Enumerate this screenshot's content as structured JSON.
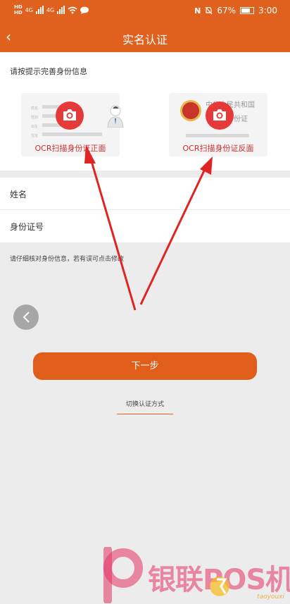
{
  "status_bar": {
    "hd1": "HD",
    "hd2": "HD",
    "net1": "4G",
    "net2": "4G",
    "battery": "67%",
    "time": "3:00"
  },
  "nav": {
    "back_glyph": "‹",
    "title": "实名认证"
  },
  "id_section": {
    "prompt": "请按提示完善身份信息",
    "front": {
      "ocr_label": "OCR扫描身份证正面",
      "fields": [
        "姓名",
        "性别",
        "出生",
        "住址"
      ]
    },
    "back": {
      "ocr_label": "OCR扫描身份证反面",
      "line1": "中华人民共和国",
      "line2": "居民身份证"
    }
  },
  "form": {
    "name_label": "姓名",
    "id_label": "身份证号"
  },
  "tip": "请仔细核对身份信息，若有误可点击修改",
  "next_button": "下一步",
  "switch_link": "切换认证方式",
  "watermark": {
    "text": "银联POS机",
    "site": "taoyouxi"
  },
  "colors": {
    "brand": "#e0601e",
    "accent_red": "#e53a3a",
    "ocr_text": "#d12e2e",
    "annotation_arrow": "#e02424"
  }
}
